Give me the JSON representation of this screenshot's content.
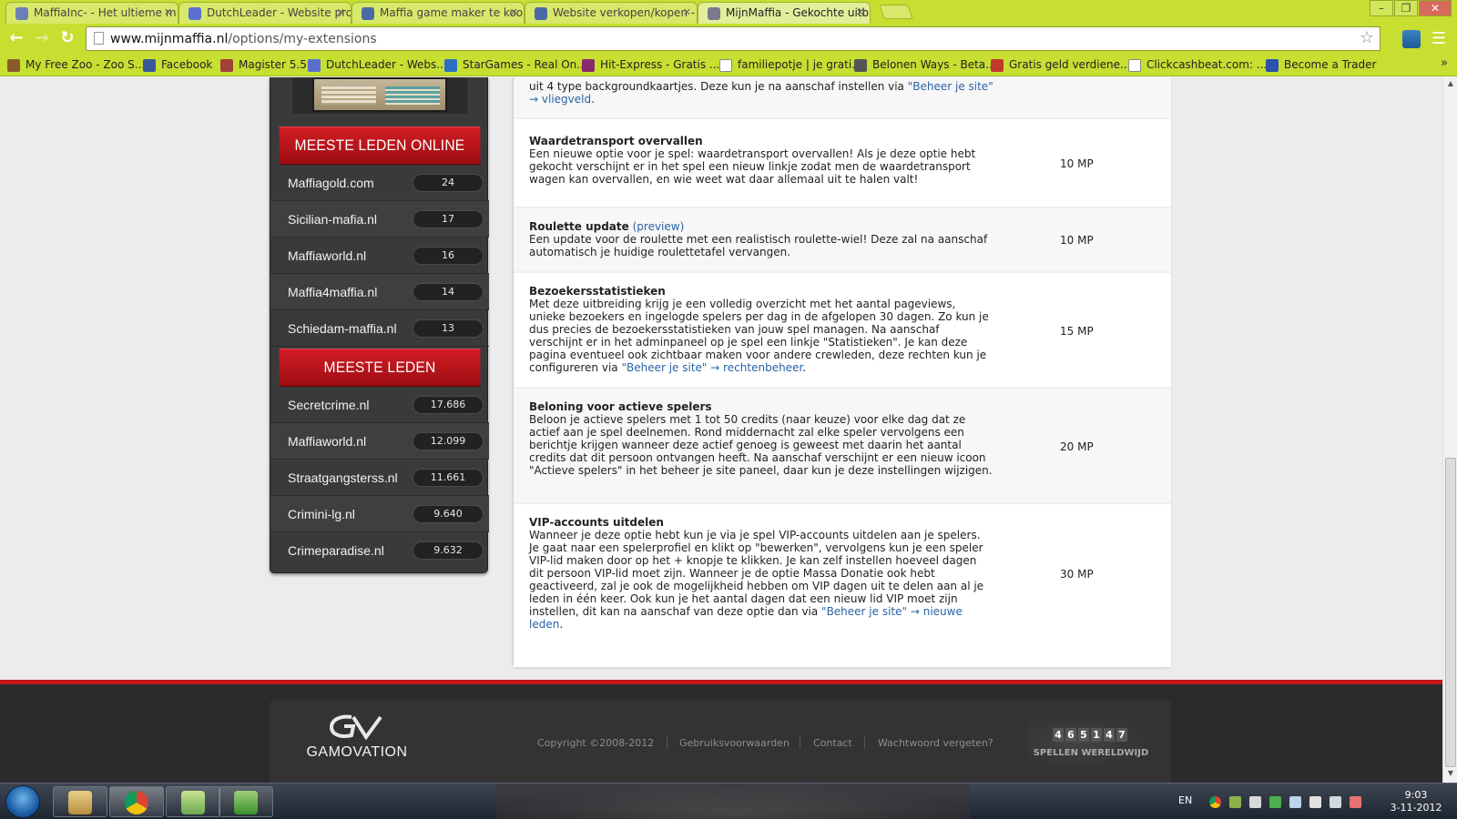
{
  "browser": {
    "tabs": [
      {
        "label": "MaffiaInc- - Het ultieme m",
        "active": false
      },
      {
        "label": "DutchLeader - Website pro",
        "active": false
      },
      {
        "label": "Maffia game maker te koo",
        "active": false
      },
      {
        "label": "Website verkopen/kopen -",
        "active": false
      },
      {
        "label": "MijnMaffia - Gekochte uitb",
        "active": true
      }
    ],
    "address": {
      "host": "www.mijnmaffia.nl",
      "path": "/options/my-extensions"
    },
    "bookmarks": [
      "My Free Zoo - Zoo S...",
      "Facebook",
      "Magister 5.5",
      "DutchLeader - Webs...",
      "StarGames - Real On...",
      "Hit-Express - Gratis ...",
      "familiepotje | je grati...",
      "Belonen Ways - Beta...",
      "Gratis geld verdiene...",
      "Clickcashbeat.com: ...",
      "Become a Trader"
    ],
    "accent_color": "#c6df31"
  },
  "sidebar": {
    "online_heading": "MEESTE LEDEN ONLINE",
    "online": [
      {
        "name": "Maffiagold.com",
        "count": "24"
      },
      {
        "name": "Sicilian-mafia.nl",
        "count": "17"
      },
      {
        "name": "Maffiaworld.nl",
        "count": "16"
      },
      {
        "name": "Maffia4maffia.nl",
        "count": "14"
      },
      {
        "name": "Schiedam-maffia.nl",
        "count": "13"
      }
    ],
    "members_heading": "MEESTE LEDEN",
    "members": [
      {
        "name": "Secretcrime.nl",
        "count": "17.686"
      },
      {
        "name": "Maffiaworld.nl",
        "count": "12.099"
      },
      {
        "name": "Straatgangsterss.nl",
        "count": "11.661"
      },
      {
        "name": "Crimini-lg.nl",
        "count": "9.640"
      },
      {
        "name": "Crimeparadise.nl",
        "count": "9.632"
      }
    ]
  },
  "extensions": {
    "partial": {
      "text_before": "uit 4 type backgroundkaartjes. Deze kun je na aanschaf instellen via ",
      "link1": "\"Beheer je site\" → vliegveld",
      "text_after": "."
    },
    "items": [
      {
        "title": "Waardetransport overvallen",
        "preview": "",
        "body": "Een nieuwe optie voor je spel: waardetransport overvallen! Als je deze optie hebt gekocht verschijnt er in het spel een nieuw linkje zodat men de waardetransport wagen kan overvallen, en wie weet wat daar allemaal uit te halen valt!",
        "link": "",
        "tail": "",
        "price": "10 MP"
      },
      {
        "title": "Roulette update",
        "preview": "(preview)",
        "body": "Een update voor de roulette met een realistisch roulette-wiel! Deze zal na aanschaf automatisch je huidige roulettetafel vervangen.",
        "link": "",
        "tail": "",
        "price": "10 MP"
      },
      {
        "title": "Bezoekersstatistieken",
        "preview": "",
        "body": "Met deze uitbreiding krijg je een volledig overzicht met het aantal pageviews, unieke bezoekers en ingelogde spelers per dag in de afgelopen 30 dagen. Zo kun je dus precies de bezoekersstatistieken van jouw spel managen. Na aanschaf verschijnt er in het adminpaneel op je spel een linkje \"Statistieken\". Je kan deze pagina eventueel ook zichtbaar maken voor andere crewleden, deze rechten kun je configureren via ",
        "link": "\"Beheer je site\" → rechtenbeheer",
        "tail": ".",
        "price": "15 MP"
      },
      {
        "title": "Beloning voor actieve spelers",
        "preview": "",
        "body": "Beloon je actieve spelers met 1 tot 50 credits (naar keuze) voor elke dag dat ze actief aan je spel deelnemen. Rond middernacht zal elke speler vervolgens een berichtje krijgen wanneer deze actief genoeg is geweest met daarin het aantal credits dat dit persoon ontvangen heeft. Na aanschaf verschijnt er een nieuw icoon \"Actieve spelers\" in het beheer je site paneel, daar kun je deze instellingen wijzigen.",
        "link": "",
        "tail": "",
        "price": "20 MP"
      },
      {
        "title": "VIP-accounts uitdelen",
        "preview": "",
        "body": "Wanneer je deze optie hebt kun je via je spel VIP-accounts uitdelen aan je spelers. Je gaat naar een spelerprofiel en klikt op \"bewerken\", vervolgens kun je een speler VIP-lid maken door op het + knopje te klikken. Je kan zelf instellen hoeveel dagen dit persoon VIP-lid moet zijn. Wanneer je de optie Massa Donatie ook hebt geactiveerd, zal je ook de mogelijkheid hebben om VIP dagen uit te delen aan al je leden in één keer. Ook kun je het aantal dagen dat een nieuw lid VIP moet zijn instellen, dit kan na aanschaf van deze optie dan via ",
        "link": "\"Beheer je site\" → nieuwe leden",
        "tail": ".",
        "price": "30 MP"
      }
    ]
  },
  "footer": {
    "brand": "GAMOVATION",
    "copyright": "Copyright ©2008-2012",
    "links": [
      "Gebruiksvoorwaarden",
      "Contact",
      "Wachtwoord vergeten?"
    ],
    "counter_digits": [
      "4",
      "6",
      "5",
      "1",
      "4",
      "7"
    ],
    "counter_label": "SPELLEN WERELDWIJD"
  },
  "taskbar": {
    "language": "EN",
    "time": "9:03",
    "date": "3-11-2012"
  }
}
